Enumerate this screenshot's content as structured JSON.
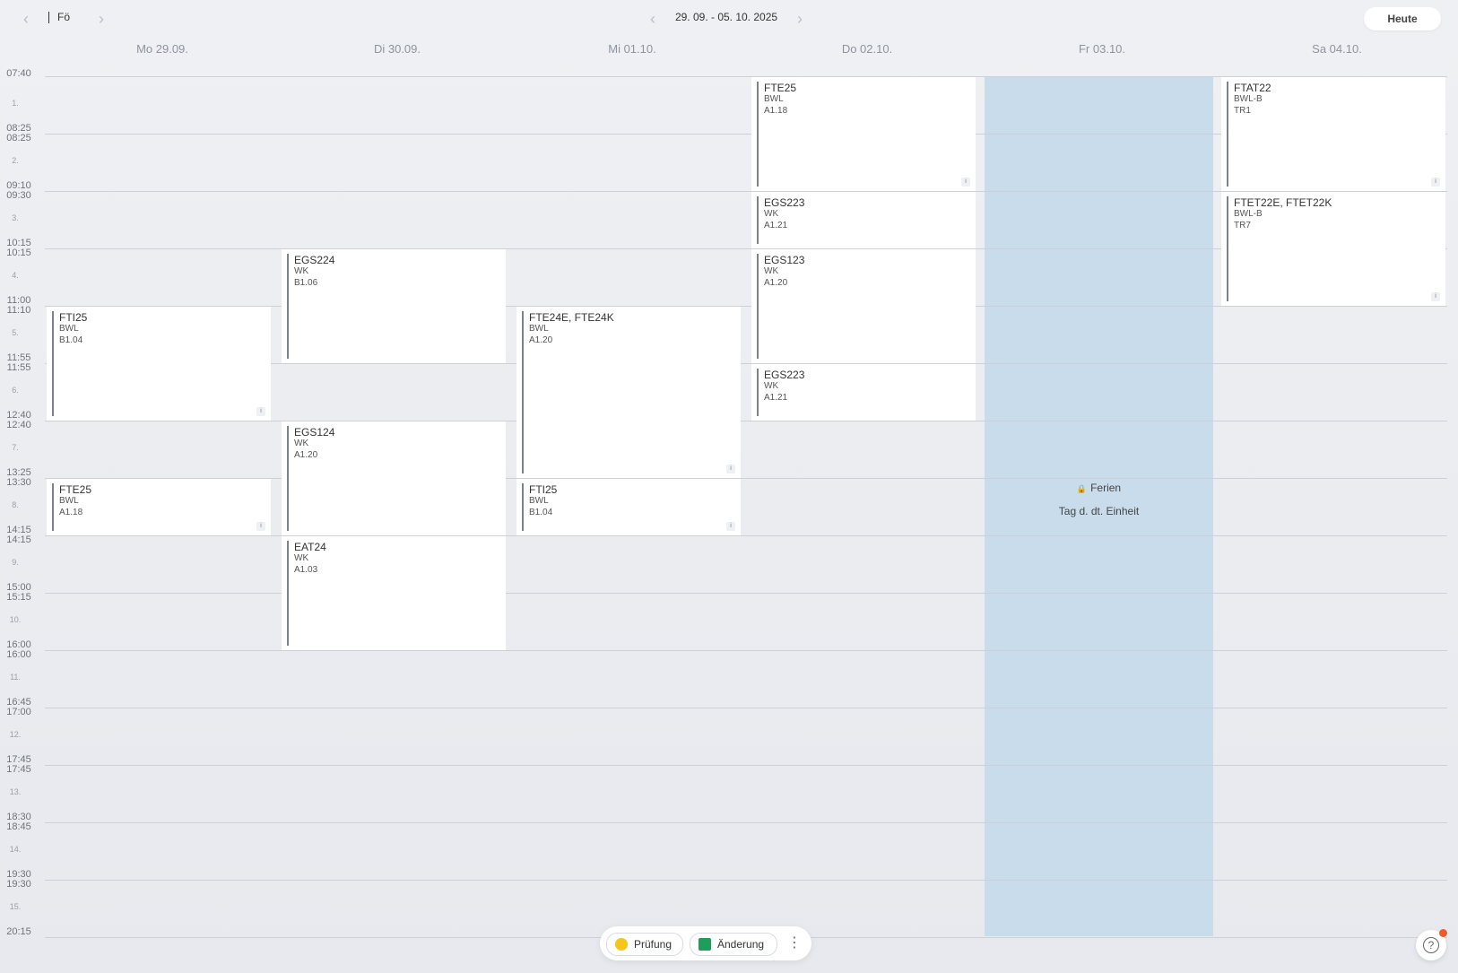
{
  "toolbar": {
    "class_name": "Fö",
    "week_range": "29. 09. - 05. 10. 2025",
    "today_label": "Heute",
    "prev_icon": "chevron-left-icon",
    "next_icon": "chevron-right-icon"
  },
  "days": [
    "Mo 29.09.",
    "Di 30.09.",
    "Mi 01.10.",
    "Do 02.10.",
    "Fr 03.10.",
    "Sa 04.10."
  ],
  "periods": [
    {
      "num": "1.",
      "start": "07:40",
      "end": "08:25"
    },
    {
      "num": "2.",
      "start": "08:25",
      "end": "09:10"
    },
    {
      "num": "3.",
      "start": "09:30",
      "end": "10:15"
    },
    {
      "num": "4.",
      "start": "10:15",
      "end": "11:00"
    },
    {
      "num": "5.",
      "start": "11:10",
      "end": "11:55"
    },
    {
      "num": "6.",
      "start": "11:55",
      "end": "12:40"
    },
    {
      "num": "7.",
      "start": "12:40",
      "end": "13:25"
    },
    {
      "num": "8.",
      "start": "13:30",
      "end": "14:15"
    },
    {
      "num": "9.",
      "start": "14:15",
      "end": "15:00"
    },
    {
      "num": "10.",
      "start": "15:15",
      "end": "16:00"
    },
    {
      "num": "11.",
      "start": "16:00",
      "end": "16:45"
    },
    {
      "num": "12.",
      "start": "17:00",
      "end": "17:45"
    },
    {
      "num": "13.",
      "start": "17:45",
      "end": "18:30"
    },
    {
      "num": "14.",
      "start": "18:45",
      "end": "19:30"
    },
    {
      "num": "15.",
      "start": "19:30",
      "end": "20:15"
    }
  ],
  "lessons": [
    {
      "day": 0,
      "start": 5,
      "end": 6,
      "class": "FTI25",
      "subject": "BWL",
      "room": "B1.04",
      "info": "i"
    },
    {
      "day": 0,
      "start": 8,
      "end": 8,
      "class": "FTE25",
      "subject": "BWL",
      "room": "A1.18",
      "info": "i"
    },
    {
      "day": 1,
      "start": 4,
      "end": 5,
      "class": "EGS224",
      "subject": "WK",
      "room": "B1.06"
    },
    {
      "day": 1,
      "start": 7,
      "end": 8,
      "class": "EGS124",
      "subject": "WK",
      "room": "A1.20"
    },
    {
      "day": 1,
      "start": 9,
      "end": 10,
      "class": "EAT24",
      "subject": "WK",
      "room": "A1.03"
    },
    {
      "day": 2,
      "start": 5,
      "end": 7,
      "class": "FTE24E, FTE24K",
      "subject": "BWL",
      "room": "A1.20",
      "info": "i"
    },
    {
      "day": 2,
      "start": 8,
      "end": 8,
      "class": "FTI25",
      "subject": "BWL",
      "room": "B1.04",
      "info": "i"
    },
    {
      "day": 3,
      "start": 1,
      "end": 2,
      "class": "FTE25",
      "subject": "BWL",
      "room": "A1.18",
      "info": "i"
    },
    {
      "day": 3,
      "start": 3,
      "end": 3,
      "class": "EGS223",
      "subject": "WK",
      "room": "A1.21"
    },
    {
      "day": 3,
      "start": 4,
      "end": 5,
      "class": "EGS123",
      "subject": "WK",
      "room": "A1.20"
    },
    {
      "day": 3,
      "start": 6,
      "end": 6,
      "class": "EGS223",
      "subject": "WK",
      "room": "A1.21"
    },
    {
      "day": 5,
      "start": 1,
      "end": 2,
      "class": "FTAT22",
      "subject": "BWL-B",
      "room": "TR1",
      "info": "i"
    },
    {
      "day": 5,
      "start": 3,
      "end": 4,
      "class": "FTET22E, FTET22K",
      "subject": "BWL-B",
      "room": "TR7",
      "info": "i"
    }
  ],
  "holiday": {
    "day": 4,
    "title": "Ferien",
    "subtitle": "Tag d. dt. Einheit",
    "icon": "lock-icon",
    "color": "#c8dcec"
  },
  "legend": {
    "items": [
      {
        "label": "Prüfung",
        "color": "#f5c518"
      },
      {
        "label": "Änderung",
        "color": "#1e9e5a"
      }
    ],
    "more_icon": "more-vertical-icon"
  },
  "help": {
    "icon": "help-icon",
    "notification_color": "#f05a28"
  }
}
